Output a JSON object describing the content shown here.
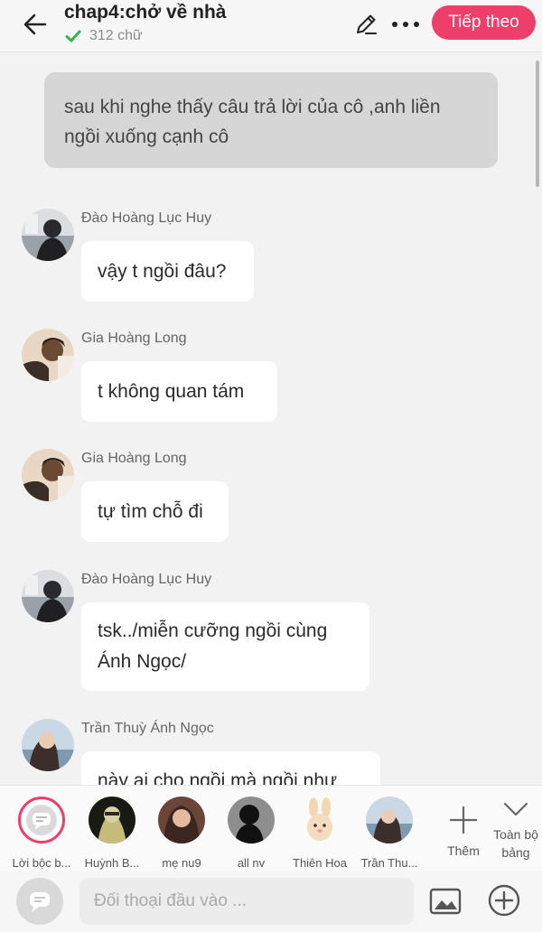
{
  "header": {
    "title": "chap4:chở về nhà",
    "word_count": "312 chữ",
    "next_label": "Tiếp theo"
  },
  "colors": {
    "accent": "#ee3f6a",
    "verified": "#2db84d"
  },
  "chat": {
    "narration": "sau khi nghe thấy câu trả lời của cô ,anh liền ngồi xuống cạnh cô",
    "messages": [
      {
        "name": "Đào Hoàng Lục Huy",
        "text": "vậy t ngồi đâu?"
      },
      {
        "name": "Gia Hoàng Long",
        "text": "t không quan tám"
      },
      {
        "name": "Gia Hoàng Long",
        "text": "tự tìm chỗ đi"
      },
      {
        "name": "Đào Hoàng Lục Huy",
        "text": "tsk../miễn cưỡng ngồi cùng Ánh Ngọc/"
      },
      {
        "name": "Trần Thuỳ Ánh Ngọc",
        "text": "này ai cho ngồi mà ngồi như"
      }
    ]
  },
  "characters": {
    "items": [
      {
        "label": "Lời bộc b..."
      },
      {
        "label": "Huỳnh B..."
      },
      {
        "label": "mẹ nu9"
      },
      {
        "label": "all nv"
      },
      {
        "label": "Thiên Hoa"
      },
      {
        "label": "Trần Thu..."
      }
    ],
    "add_label": "Thêm",
    "all_label": "Toàn bộ bảng"
  },
  "input": {
    "placeholder": "Đối thoại đầu vào ..."
  }
}
